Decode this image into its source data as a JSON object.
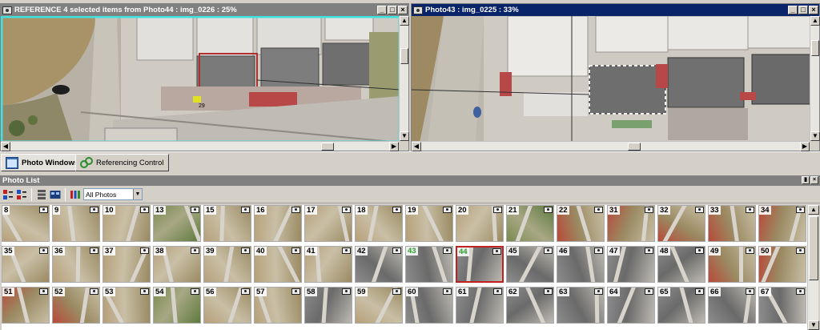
{
  "left_window": {
    "title": "REFERENCE 4 selected items from Photo44 : img_0226 : 25%",
    "marker_label": "29"
  },
  "right_window": {
    "title": "Photo43 : img_0225 : 33%"
  },
  "tabs": [
    {
      "label": "Photo Windows",
      "selected": true
    },
    {
      "label": "Referencing Control",
      "selected": false
    }
  ],
  "photo_list": {
    "header": "Photo List",
    "filter_selected": "All Photos",
    "thumbnails": [
      {
        "num": "8",
        "tone": "dry"
      },
      {
        "num": "9",
        "tone": "dry"
      },
      {
        "num": "10",
        "tone": "dry"
      },
      {
        "num": "13",
        "tone": "green"
      },
      {
        "num": "15",
        "tone": "dry"
      },
      {
        "num": "16",
        "tone": "dry"
      },
      {
        "num": "17",
        "tone": "dry"
      },
      {
        "num": "18",
        "tone": "dry"
      },
      {
        "num": "19",
        "tone": "dry"
      },
      {
        "num": "20",
        "tone": "dry"
      },
      {
        "num": "21",
        "tone": "green"
      },
      {
        "num": "22",
        "tone": "red"
      },
      {
        "num": "31",
        "tone": "red"
      },
      {
        "num": "32",
        "tone": "red"
      },
      {
        "num": "33",
        "tone": "red"
      },
      {
        "num": "34",
        "tone": "red"
      },
      {
        "num": "35",
        "tone": "dry"
      },
      {
        "num": "36",
        "tone": "dry"
      },
      {
        "num": "37",
        "tone": "dry"
      },
      {
        "num": "38",
        "tone": "dry"
      },
      {
        "num": "39",
        "tone": "dry"
      },
      {
        "num": "40",
        "tone": "dry"
      },
      {
        "num": "41",
        "tone": "dry"
      },
      {
        "num": "42",
        "tone": "urban"
      },
      {
        "num": "43",
        "tone": "urban",
        "green": true
      },
      {
        "num": "44",
        "tone": "urban",
        "green": true,
        "selected": true
      },
      {
        "num": "45",
        "tone": "urban"
      },
      {
        "num": "46",
        "tone": "urban"
      },
      {
        "num": "47",
        "tone": "urban"
      },
      {
        "num": "48",
        "tone": "urban"
      },
      {
        "num": "49",
        "tone": "red"
      },
      {
        "num": "50",
        "tone": "red"
      },
      {
        "num": "51",
        "tone": "red"
      },
      {
        "num": "52",
        "tone": "red"
      },
      {
        "num": "53",
        "tone": "dry"
      },
      {
        "num": "54",
        "tone": "green"
      },
      {
        "num": "56",
        "tone": "dry"
      },
      {
        "num": "57",
        "tone": "dry"
      },
      {
        "num": "58",
        "tone": "urban"
      },
      {
        "num": "59",
        "tone": "dry"
      },
      {
        "num": "60",
        "tone": "urban"
      },
      {
        "num": "61",
        "tone": "urban"
      },
      {
        "num": "62",
        "tone": "urban"
      },
      {
        "num": "63",
        "tone": "urban"
      },
      {
        "num": "64",
        "tone": "urban"
      },
      {
        "num": "65",
        "tone": "urban"
      },
      {
        "num": "66",
        "tone": "urban"
      },
      {
        "num": "67",
        "tone": "urban"
      }
    ]
  },
  "colors": {
    "active_title": "#0a246a",
    "inactive_title": "#808080",
    "reference_outline": "#40e0e0",
    "selection_red": "#c02020",
    "green_number": "#2ca02c"
  }
}
